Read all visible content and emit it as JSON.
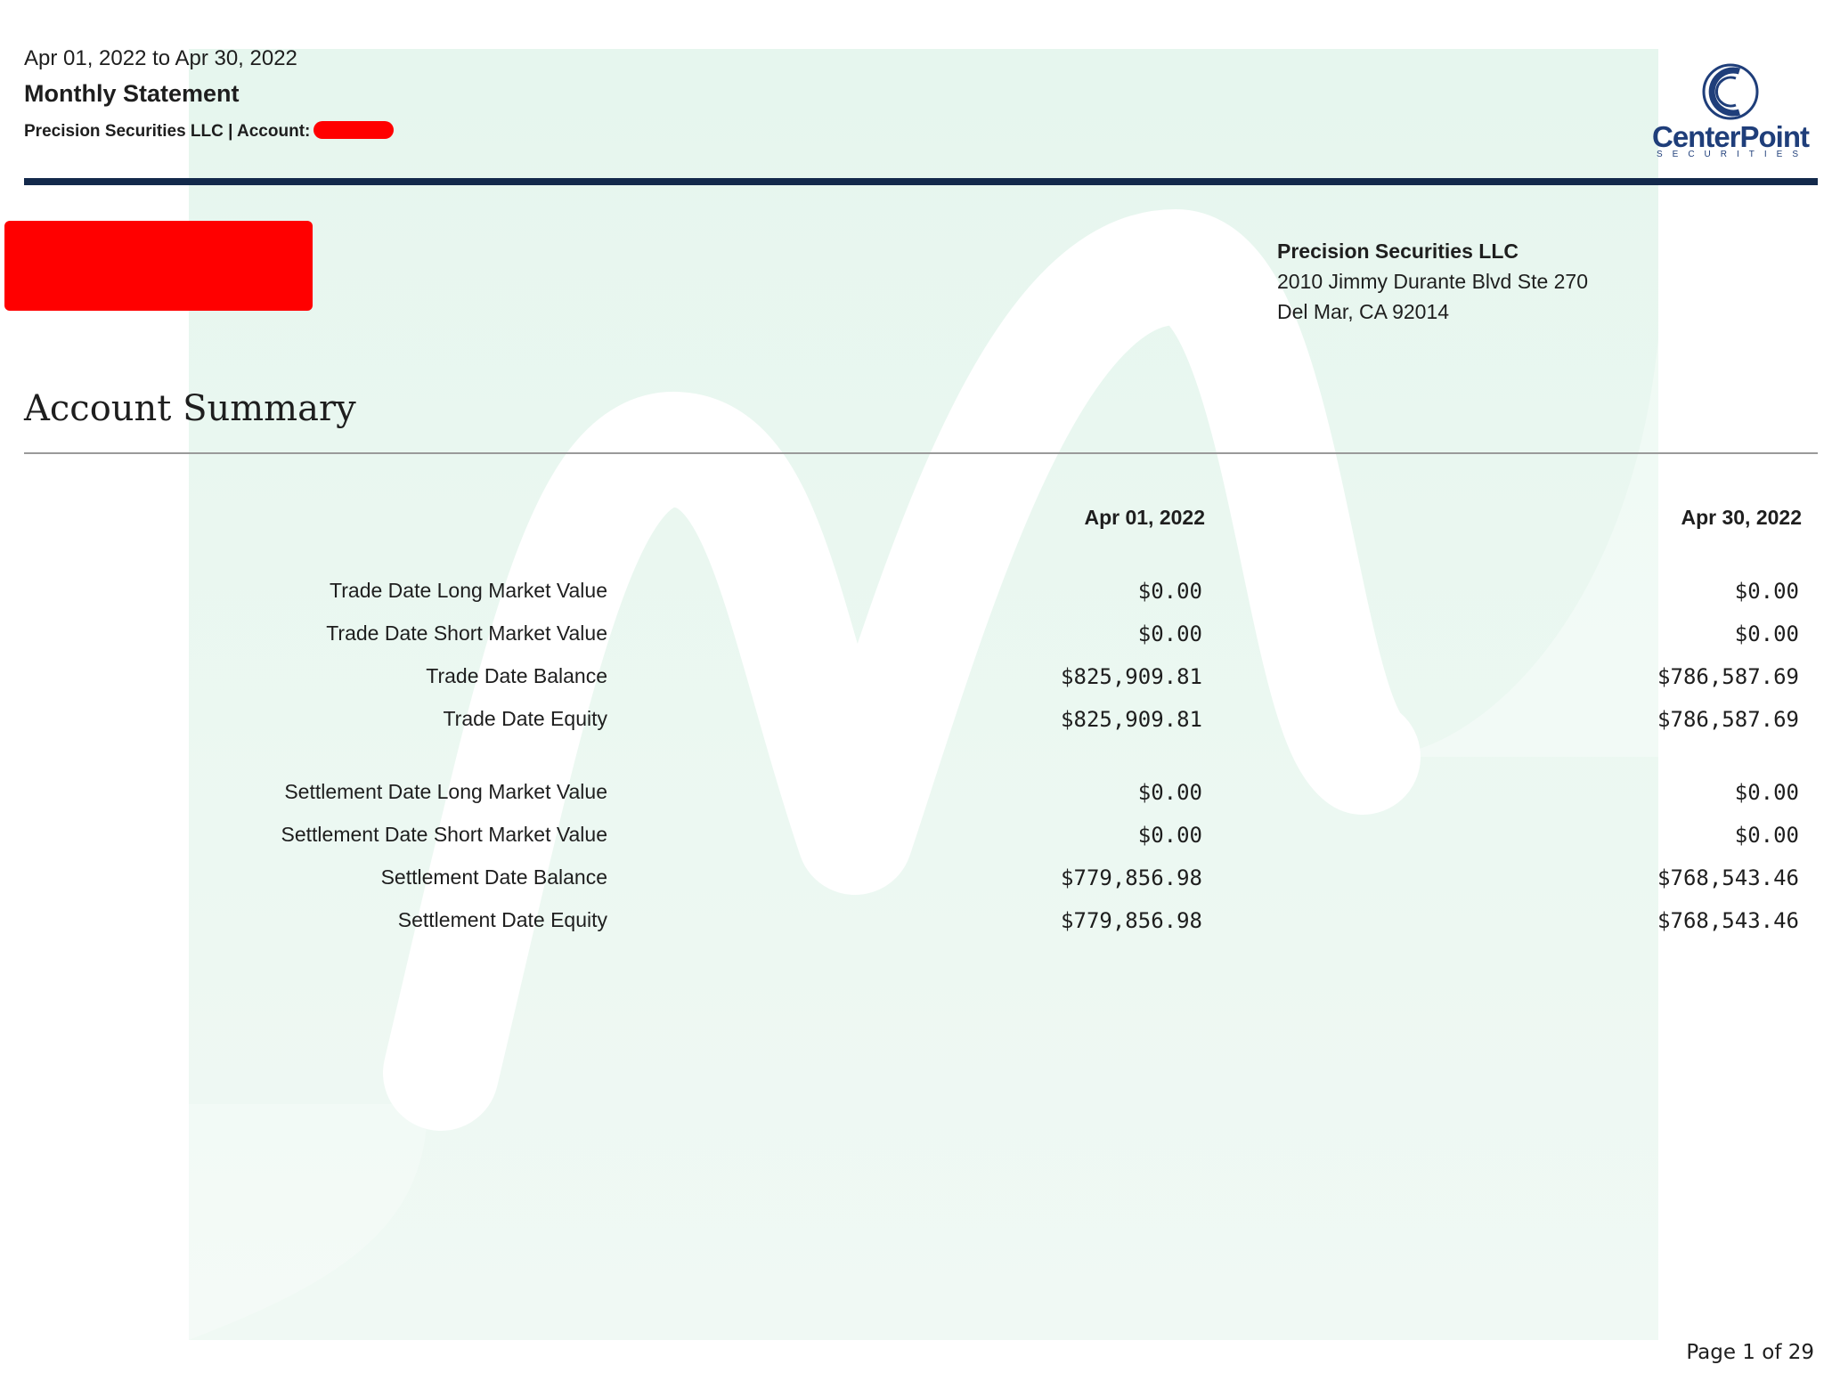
{
  "header": {
    "date_range": "Apr 01, 2022 to Apr 30, 2022",
    "title": "Monthly Statement",
    "subline": "Precision Securities LLC | Account:"
  },
  "logo": {
    "name": "CenterPoint",
    "tagline": "SECURITIES",
    "icon": "centerpoint-c-logo-icon"
  },
  "address": {
    "name": "Precision Securities LLC",
    "line1": "2010 Jimmy Durante Blvd Ste 270",
    "line2": "Del Mar, CA 92014"
  },
  "summary": {
    "title": "Account Summary",
    "columns": [
      "Apr 01, 2022",
      "Apr 30, 2022"
    ],
    "trade_rows": [
      {
        "label": "Trade Date Long Market Value",
        "start": "$0.00",
        "end": "$0.00"
      },
      {
        "label": "Trade Date Short Market Value",
        "start": "$0.00",
        "end": "$0.00"
      },
      {
        "label": "Trade Date Balance",
        "start": "$825,909.81",
        "end": "$786,587.69"
      },
      {
        "label": "Trade Date Equity",
        "start": "$825,909.81",
        "end": "$786,587.69"
      }
    ],
    "settlement_rows": [
      {
        "label": "Settlement Date Long Market Value",
        "start": "$0.00",
        "end": "$0.00"
      },
      {
        "label": "Settlement Date Short Market Value",
        "start": "$0.00",
        "end": "$0.00"
      },
      {
        "label": "Settlement Date Balance",
        "start": "$779,856.98",
        "end": "$768,543.46"
      },
      {
        "label": "Settlement Date Equity",
        "start": "$779,856.98",
        "end": "$768,543.46"
      }
    ]
  },
  "colors": {
    "brand_navy": "#13294b",
    "logo_blue": "#1f3e7a",
    "watermark_green": "#e8f7ef",
    "redaction": "#ff0000"
  },
  "footer": {
    "page_label": "Page 1 of 29"
  }
}
